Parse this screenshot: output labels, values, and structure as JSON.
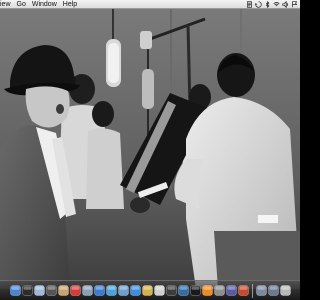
{
  "menubar": {
    "items": [
      "iew",
      "Go",
      "Window",
      "Help"
    ],
    "status_icons": [
      "script-icon",
      "sync-icon",
      "bluetooth-icon",
      "wifi-icon",
      "volume-icon",
      "flag-icon"
    ]
  },
  "desktop": {
    "wallpaper": "black-and-white-recording-studio-photo"
  },
  "dock": {
    "apps_left": [
      {
        "icon": "finder-icon",
        "color": "#4a86d8"
      },
      {
        "icon": "dashboard-icon",
        "color": "#2c2c2c"
      },
      {
        "icon": "mail-icon",
        "color": "#9fb7d8"
      },
      {
        "icon": "camera-icon",
        "color": "#555555"
      },
      {
        "icon": "address-book-icon",
        "color": "#c9a36b"
      },
      {
        "icon": "ical-icon",
        "color": "#d83a3a"
      },
      {
        "icon": "preview-icon",
        "color": "#8aa0b8"
      },
      {
        "icon": "itunes-icon",
        "color": "#3b7bd6"
      },
      {
        "icon": "ichat-icon",
        "color": "#4aa3e0"
      },
      {
        "icon": "iphoto-icon",
        "color": "#6e9fcf"
      },
      {
        "icon": "safari-icon",
        "color": "#3a8fe0"
      },
      {
        "icon": "folder-icon",
        "color": "#d4b24a"
      },
      {
        "icon": "spotlight-icon",
        "color": "#cfcfcf"
      },
      {
        "icon": "facetime-icon",
        "color": "#3c3c3c"
      },
      {
        "icon": "time-machine-icon",
        "color": "#2e6fa8"
      },
      {
        "icon": "terminal-icon",
        "color": "#1a1a1a"
      },
      {
        "icon": "vlc-icon",
        "color": "#f08a1c"
      },
      {
        "icon": "preferences-icon",
        "color": "#8f8f8f"
      },
      {
        "icon": "shield-icon",
        "color": "#5a5aa8"
      },
      {
        "icon": "flame-icon",
        "color": "#c84a2a"
      }
    ],
    "apps_right": [
      {
        "icon": "documents-stack-icon",
        "color": "#7a8aa0"
      },
      {
        "icon": "downloads-stack-icon",
        "color": "#6a7a90"
      },
      {
        "icon": "trash-icon",
        "color": "#b8b8b8"
      }
    ]
  }
}
